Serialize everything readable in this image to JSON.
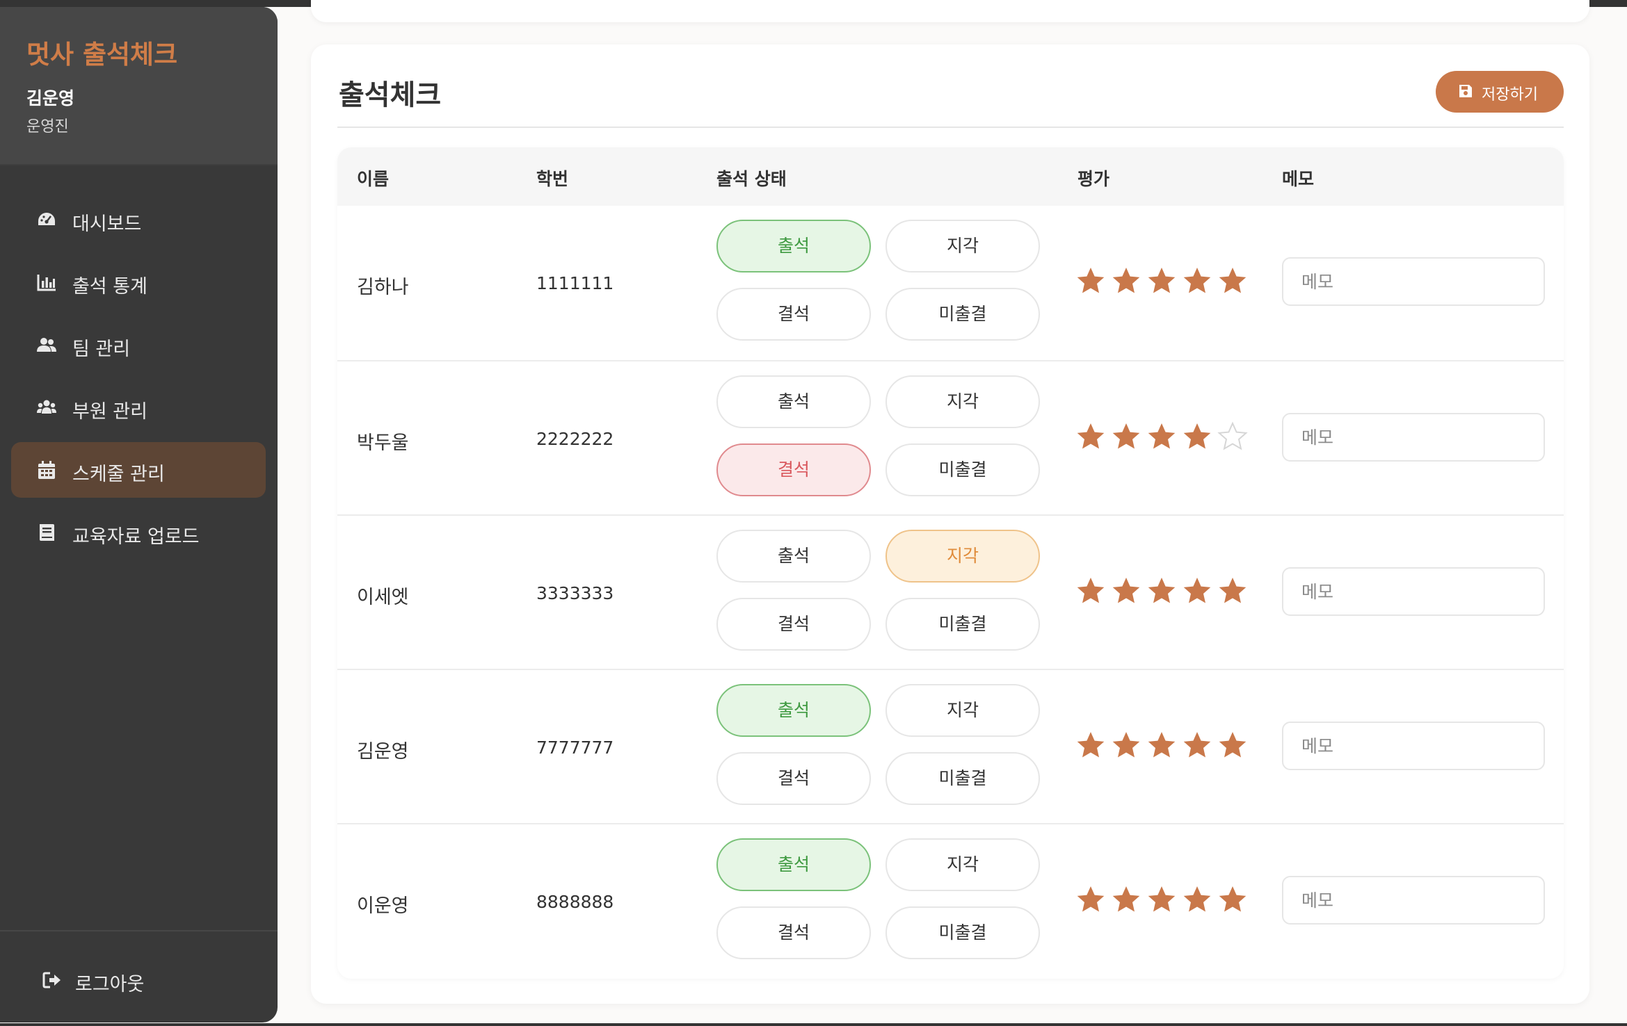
{
  "sidebar": {
    "brand": "멋사 출석체크",
    "user_name": "김운영",
    "user_role": "운영진",
    "items": [
      {
        "label": "대시보드",
        "icon": "dashboard-icon",
        "active": false
      },
      {
        "label": "출석 통계",
        "icon": "bar-chart-icon",
        "active": false
      },
      {
        "label": "팀 관리",
        "icon": "users-icon",
        "active": false
      },
      {
        "label": "부원 관리",
        "icon": "users-group-icon",
        "active": false
      },
      {
        "label": "스케줄 관리",
        "icon": "calendar-icon",
        "active": true
      },
      {
        "label": "교육자료 업로드",
        "icon": "book-icon",
        "active": false
      }
    ],
    "logout_label": "로그아웃"
  },
  "main": {
    "title": "출석체크",
    "save_label": "저장하기",
    "columns": [
      "이름",
      "학번",
      "출석 상태",
      "평가",
      "메모"
    ],
    "status_options": [
      "출석",
      "지각",
      "결석",
      "미출결"
    ],
    "memo_placeholder": "메모",
    "rows": [
      {
        "name": "김하나",
        "student_id": "1111111",
        "status": "출석",
        "rating": 5
      },
      {
        "name": "박두울",
        "student_id": "2222222",
        "status": "결석",
        "rating": 4
      },
      {
        "name": "이세엣",
        "student_id": "3333333",
        "status": "지각",
        "rating": 5
      },
      {
        "name": "김운영",
        "student_id": "7777777",
        "status": "출석",
        "rating": 5
      },
      {
        "name": "이운영",
        "student_id": "8888888",
        "status": "출석",
        "rating": 5
      }
    ],
    "rating_max": 5
  },
  "colors": {
    "accent": "#c9784a",
    "brand": "#d07d48",
    "sidebar_bg": "#393939",
    "sidebar_active": "#5d4535",
    "star_filled": "#c9784a",
    "star_empty": "#d6d6d6",
    "present": "#3f9a41",
    "absent": "#d9585e",
    "late": "#e08c3b"
  }
}
